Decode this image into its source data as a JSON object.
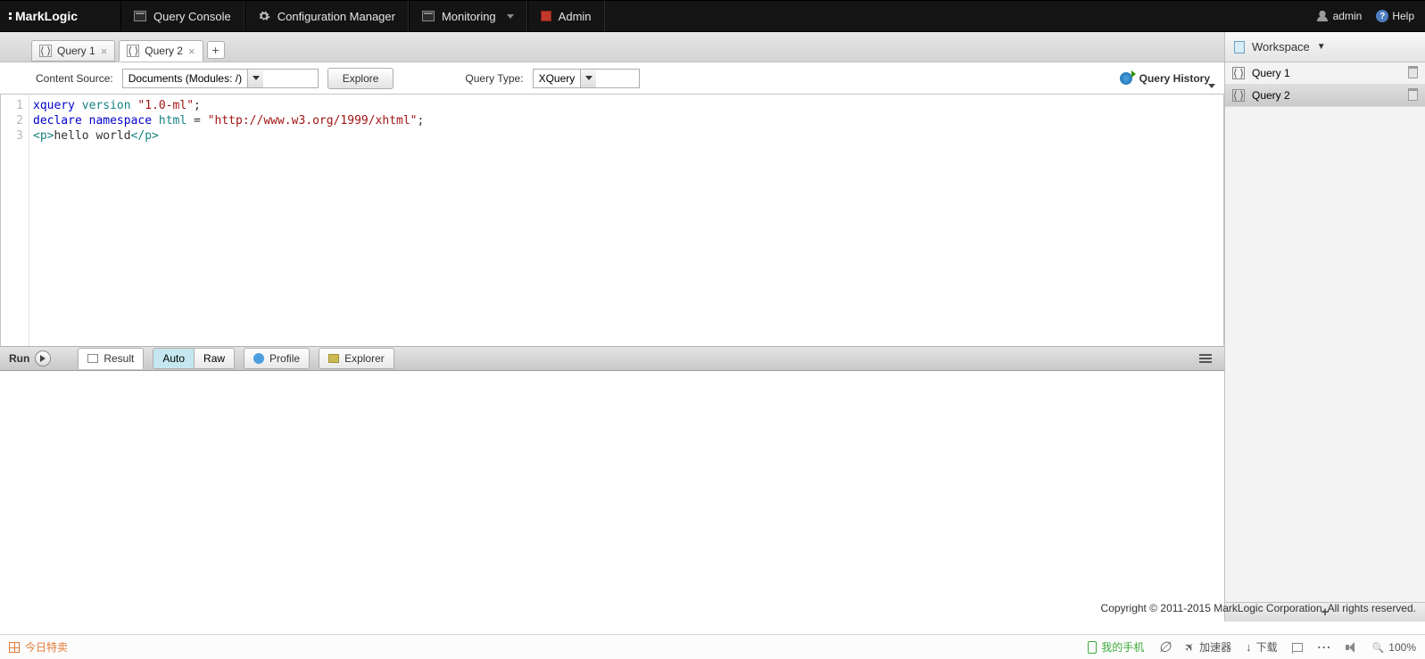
{
  "brand": "MarkLogic",
  "nav": {
    "queryConsole": "Query Console",
    "configManager": "Configuration Manager",
    "monitoring": "Monitoring",
    "admin": "Admin"
  },
  "user": {
    "name": "admin",
    "help": "Help"
  },
  "tabs": [
    {
      "label": "Query 1"
    },
    {
      "label": "Query 2"
    }
  ],
  "activeTab": 1,
  "toolbar": {
    "contentSourceLabel": "Content Source:",
    "contentSourceValue": "Documents (Modules: /)",
    "explore": "Explore",
    "queryTypeLabel": "Query Type:",
    "queryTypeValue": "XQuery",
    "queryHistory": "Query History"
  },
  "code": {
    "line1": {
      "kw1": "xquery",
      "kw2": "version",
      "str": "\"1.0-ml\"",
      "end": ";"
    },
    "line2": {
      "kw1": "declare",
      "kw2": "namespace",
      "id": "html",
      "eq": " = ",
      "str": "\"http://www.w3.org/1999/xhtml\"",
      "end": ";"
    },
    "line3": {
      "open": "<p>",
      "text": "hello world",
      "close": "</p>"
    }
  },
  "resultbar": {
    "run": "Run",
    "result": "Result",
    "auto": "Auto",
    "raw": "Raw",
    "profile": "Profile",
    "explorer": "Explorer"
  },
  "workspace": {
    "title": "Workspace",
    "items": [
      "Query 1",
      "Query 2"
    ],
    "activeIdx": 1
  },
  "copyright": "Copyright © 2011-2015 MarkLogic Corporation. All rights reserved.",
  "status": {
    "hotSale": "今日特卖",
    "myPhone": "我的手机",
    "accel": "加速器",
    "download": "下载",
    "zoom": "100%"
  }
}
